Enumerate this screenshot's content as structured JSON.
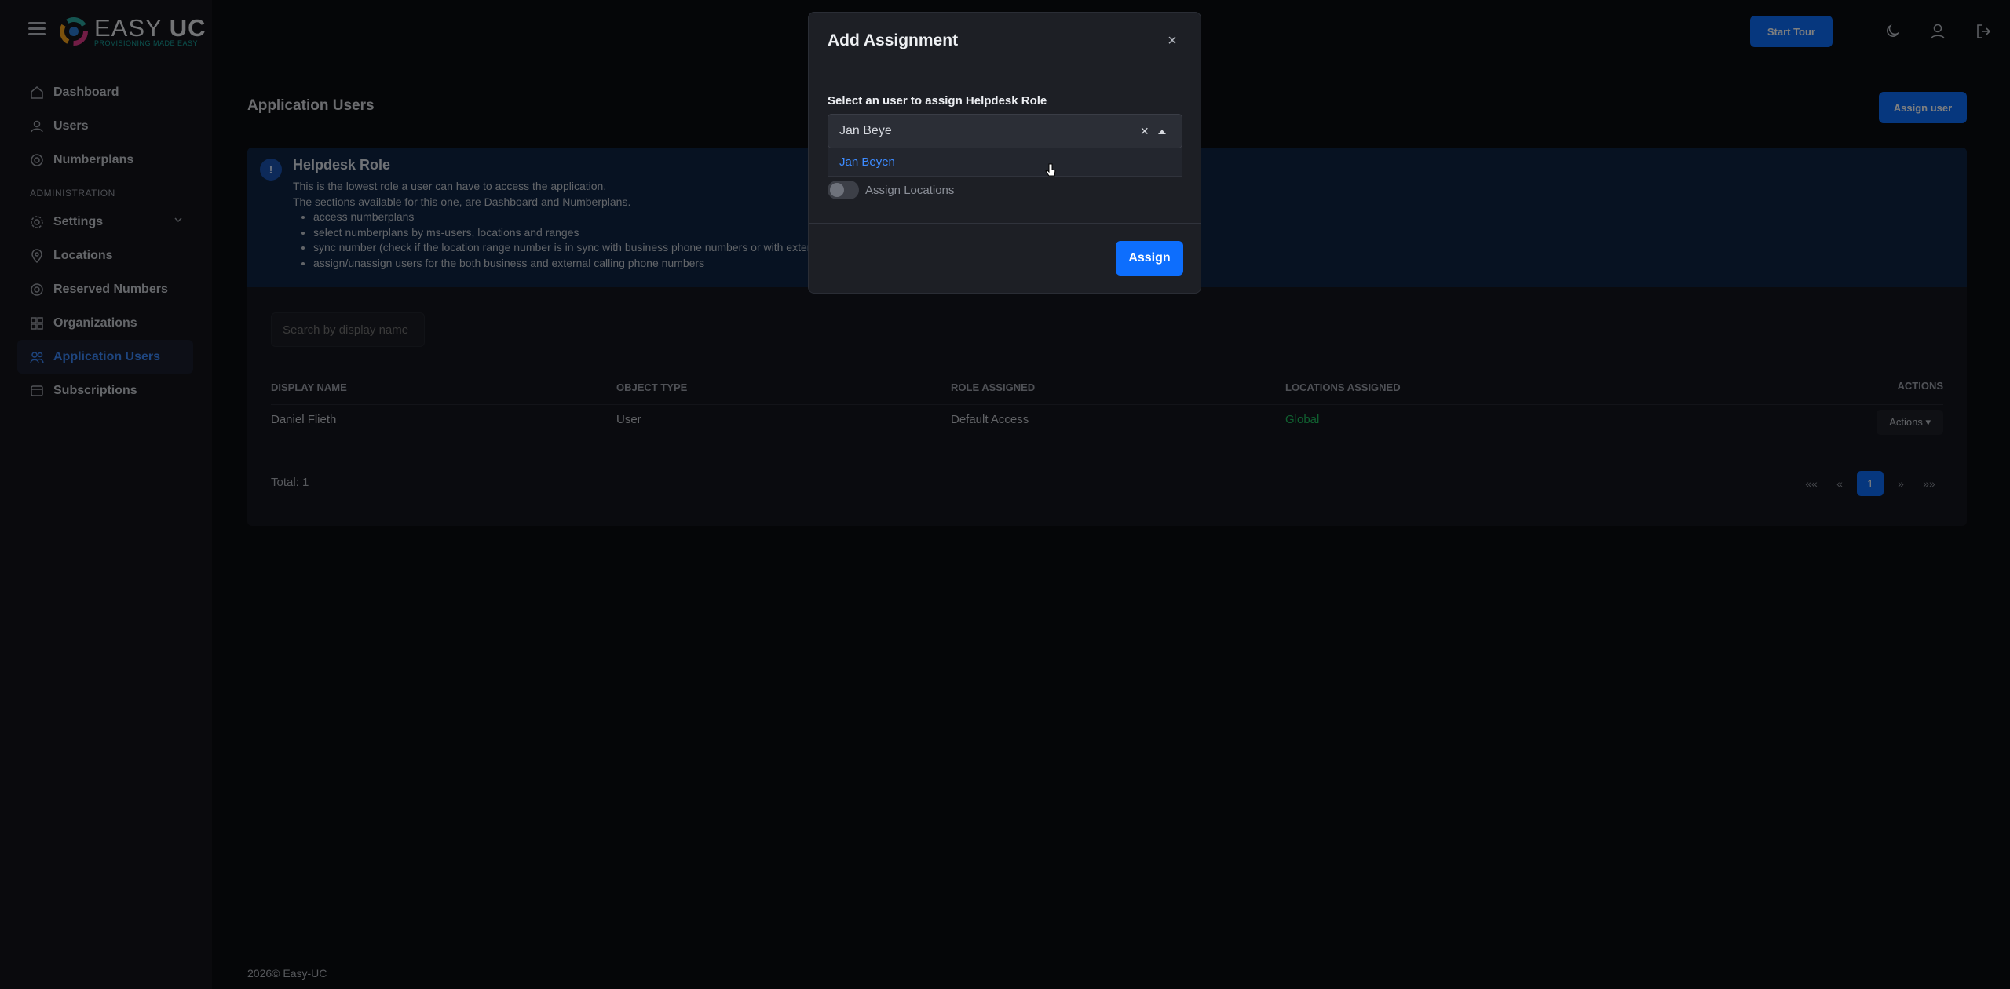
{
  "brand": {
    "name_light": "EASY",
    "name_bold": "UC",
    "tagline": "PROVISIONING MADE EASY"
  },
  "sidebar": {
    "items": [
      {
        "label": "Dashboard",
        "icon": "home-icon"
      },
      {
        "label": "Users",
        "icon": "users-icon"
      },
      {
        "label": "Numberplans",
        "icon": "numberplans-icon"
      }
    ],
    "section_label": "ADMINISTRATION",
    "admin_items": [
      {
        "label": "Settings",
        "icon": "gear-icon"
      },
      {
        "label": "Locations",
        "icon": "location-pin-icon"
      },
      {
        "label": "Reserved Numbers",
        "icon": "reserved-icon"
      },
      {
        "label": "Organizations",
        "icon": "organizations-icon"
      },
      {
        "label": "Application Users",
        "icon": "app-users-icon",
        "active": true
      },
      {
        "label": "Subscriptions",
        "icon": "subscriptions-icon"
      }
    ]
  },
  "header": {
    "start_tour": "Start Tour"
  },
  "page": {
    "title": "Application Users",
    "assign_user": "Assign user",
    "alert": {
      "title": "Helpdesk Role",
      "line1": "This is the lowest role a user can have to access the application.",
      "line2": "The sections available for this one, are Dashboard and Numberplans.",
      "bullets": [
        "access numberplans",
        "select numberplans by ms-users, locations and ranges",
        "sync number (check if the location range number is in sync with business phone numbers or with exter",
        "assign/unassign users for the both business and external calling phone numbers"
      ]
    },
    "search_placeholder": "Search by display name",
    "table": {
      "headers": [
        "DISPLAY NAME",
        "OBJECT TYPE",
        "ROLE ASSIGNED",
        "LOCATIONS ASSIGNED",
        "ACTIONS"
      ],
      "rows": [
        {
          "display_name": "Daniel Flieth",
          "object_type": "User",
          "role": "Default Access",
          "locations": "Global",
          "action": "Actions ▾"
        }
      ]
    },
    "total_label": "Total:",
    "total_value": "1",
    "pager": {
      "first": "««",
      "prev": "«",
      "current": "1",
      "next": "»",
      "last": "»»"
    }
  },
  "footer": "2026© Easy-UC",
  "modal": {
    "title": "Add Assignment",
    "label": "Select an user to assign Helpdesk Role",
    "select_value": "Jan Beye",
    "option": "Jan Beyen",
    "toggle_label": "Assign Locations",
    "toggle_on": false,
    "submit": "Assign"
  },
  "colors": {
    "primary": "#0d6efd",
    "success": "#20c060",
    "link": "#3d8bff"
  }
}
